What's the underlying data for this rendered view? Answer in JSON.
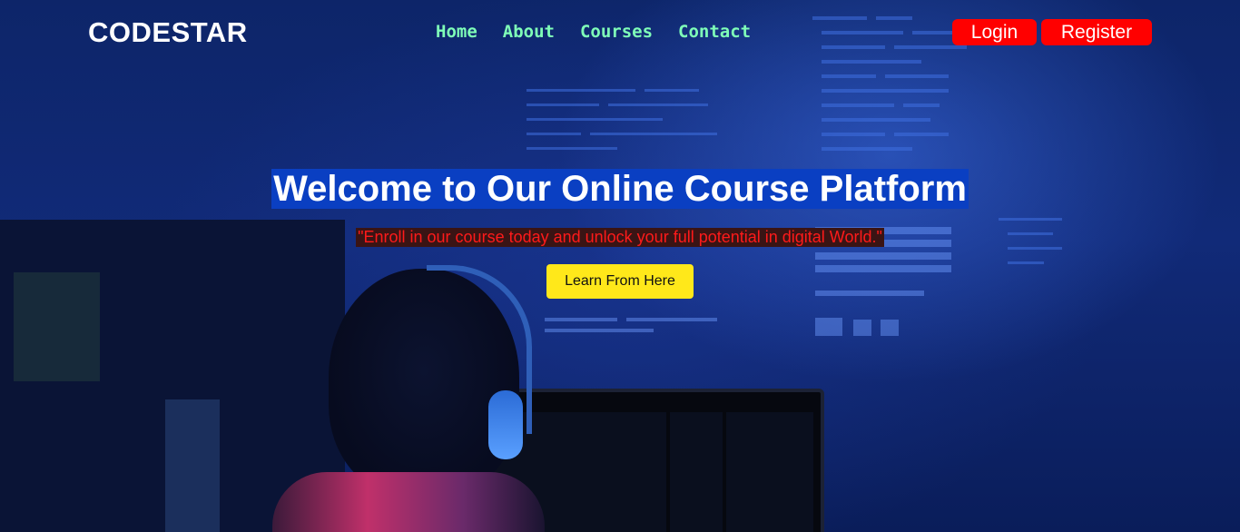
{
  "nav": {
    "logo": "CODESTAR",
    "links": [
      "Home",
      "About",
      "Courses",
      "Contact"
    ],
    "login_label": "Login",
    "register_label": "Register"
  },
  "hero": {
    "title": "Welcome to Our Online Course Platform",
    "subtitle": "\"Enroll in our course today and unlock your full potential in digital World.\"",
    "cta_label": "Learn From Here"
  },
  "colors": {
    "nav_link": "#7fffb8",
    "auth_button": "#ff0000",
    "title_highlight": "#0a3fc2",
    "subtitle_text": "#ff1a1a",
    "cta_button": "#ffe81a"
  }
}
